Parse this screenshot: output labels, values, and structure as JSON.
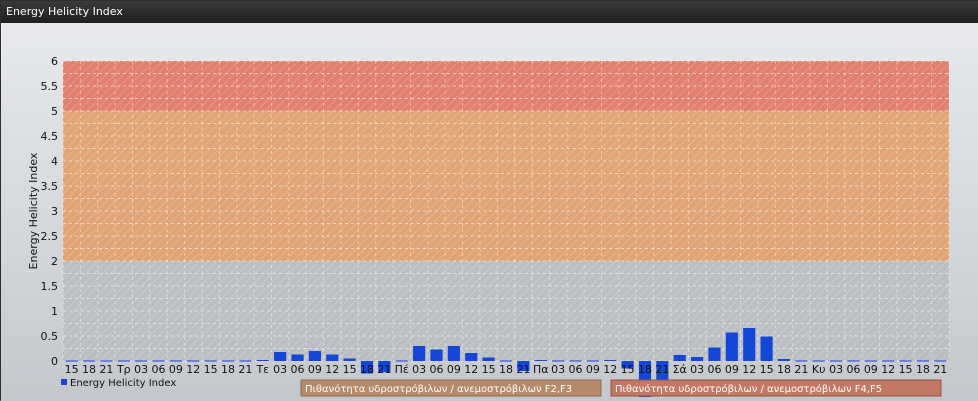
{
  "window": {
    "title": "Energy Helicity Index"
  },
  "colors": {
    "bar": "#1446d8",
    "zone_high": "#e07a66",
    "zone_mid": "#e0a06f",
    "zone_low": "#b9bdc2",
    "legend_box_1": "#b58a6a",
    "legend_box_2": "#c27865"
  },
  "chart_data": {
    "type": "bar",
    "ylabel": "Energy Helicity Index",
    "ylim": [
      0,
      6
    ],
    "yticks": [
      "0",
      "0.5",
      "1",
      "1.5",
      "2",
      "2.5",
      "3",
      "3.5",
      "4",
      "4.5",
      "5",
      "5.5",
      "6"
    ],
    "grid": true,
    "zones": [
      {
        "from": 0,
        "to": 2,
        "color": "#b9bdc2"
      },
      {
        "from": 2,
        "to": 5,
        "color": "#e0a06f"
      },
      {
        "from": 5,
        "to": 6,
        "color": "#e07a66"
      }
    ],
    "categories": [
      "15",
      "18",
      "21",
      "Τρ",
      "03",
      "06",
      "09",
      "12",
      "15",
      "18",
      "21",
      "Τε",
      "03",
      "06",
      "09",
      "12",
      "15",
      "18",
      "21",
      "Πέ",
      "03",
      "06",
      "09",
      "12",
      "15",
      "18",
      "21",
      "Πα",
      "03",
      "06",
      "09",
      "12",
      "15",
      "18",
      "21",
      "Σά",
      "03",
      "06",
      "09",
      "12",
      "15",
      "18",
      "21",
      "Κυ",
      "03",
      "06",
      "09",
      "12",
      "15",
      "18",
      "21"
    ],
    "series": [
      {
        "name": "Energy Helicity Index",
        "values": [
          0.01,
          0.01,
          0.01,
          0.01,
          0.01,
          0.01,
          0.01,
          0.01,
          0.01,
          0.01,
          0.01,
          0.02,
          0.18,
          0.13,
          0.2,
          0.13,
          0.05,
          -0.25,
          -0.22,
          0.01,
          0.3,
          0.23,
          0.3,
          0.16,
          0.07,
          0.01,
          -0.2,
          0.02,
          0.01,
          0.01,
          0.01,
          0.02,
          -0.15,
          -0.72,
          -0.45,
          0.12,
          0.08,
          0.27,
          0.57,
          0.66,
          0.49,
          0.04,
          0.01,
          0.01,
          0.01,
          0.01,
          0.01,
          0.01,
          0.01,
          0.01,
          0.01
        ]
      }
    ],
    "legend": [
      {
        "label": "Energy Helicity Index"
      },
      {
        "label": "Πιθανότητα υδροστρόβιλων / ανεμοστρόβιλων F2,F3"
      },
      {
        "label": "Πιθανότητα υδροστρόβιλων / ανεμοστρόβιλων F4,F5"
      }
    ],
    "legend_position": "bottom"
  }
}
